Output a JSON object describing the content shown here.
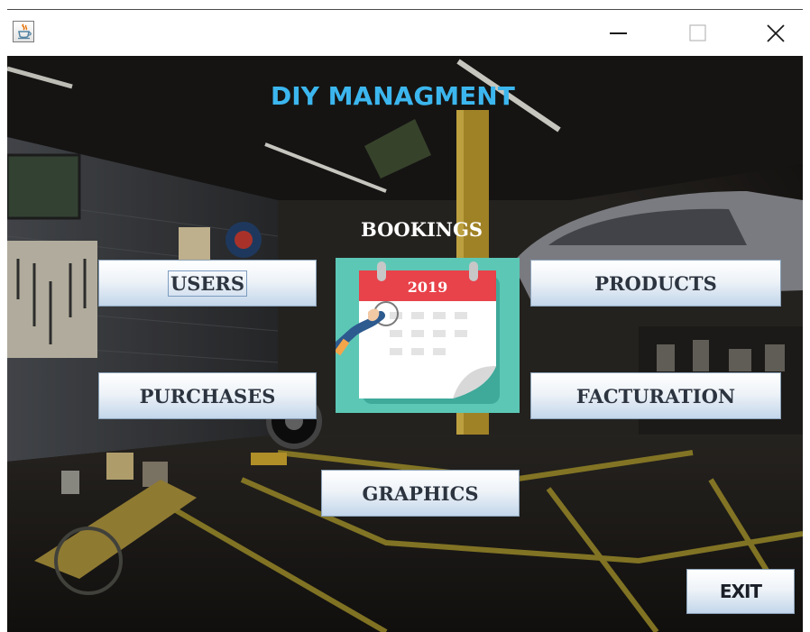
{
  "window": {
    "app_icon": "java-coffee-cup-icon",
    "controls": [
      "minimize-icon",
      "maximize-icon",
      "close-icon"
    ]
  },
  "main": {
    "title": "DIY MANAGMENT",
    "bookings_label": "BOOKINGS",
    "calendar_year": "2019",
    "buttons": {
      "users": "USERS",
      "products": "PRODUCTS",
      "purchases": "PURCHASES",
      "facturation": "FACTURATION",
      "graphics": "GRAPHICS",
      "exit": "EXIT"
    }
  },
  "colors": {
    "title": "#3cb6ee",
    "button_text": "#2c3440",
    "calendar_header": "#e8424a",
    "calendar_bg": "#5cc7b5"
  }
}
